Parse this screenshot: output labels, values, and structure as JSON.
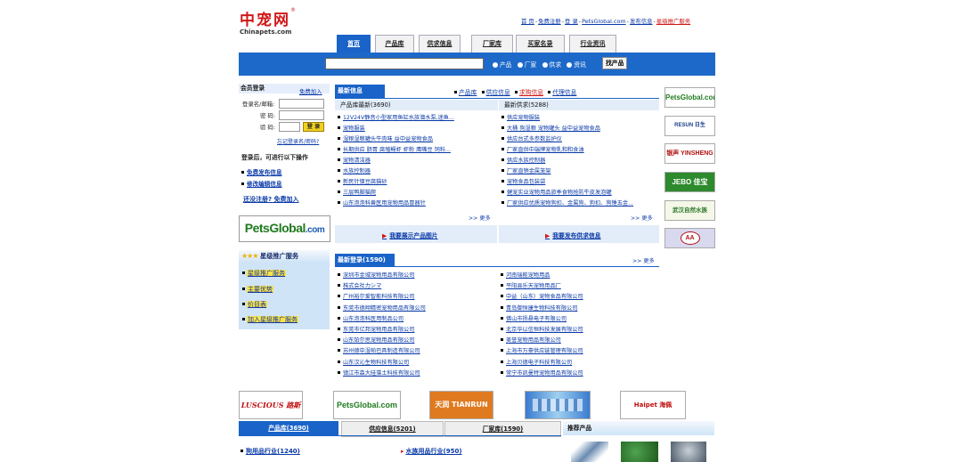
{
  "header": {
    "logo_cn": "中宠网",
    "logo_reg": "®",
    "logo_en": "Chinapets.com",
    "links": [
      "首 页",
      "免费注册",
      "登 录",
      "PetsGlobal.com",
      "发布信息"
    ],
    "promo_link": "星级推广服务"
  },
  "nav": {
    "tabs": [
      "首页",
      "产品库",
      "供求信息",
      "厂家库",
      "买家名录",
      "行业资讯"
    ],
    "active": "首页"
  },
  "search": {
    "placeholder": "",
    "options": [
      "产品",
      "厂家",
      "供求",
      "资讯"
    ],
    "button": "找产品"
  },
  "login": {
    "title": "会员登录",
    "free_join": "免费加入",
    "username_label": "登录名/邮箱:",
    "password_label": "密 码:",
    "code_label": "验 码:",
    "login_button": "登 录",
    "forgot": "忘记登录名/密码?",
    "after_login": "登录后，可进行以下操作",
    "actions": [
      "免费发布信息",
      "修改编辑信息"
    ],
    "not_registered": "还没注册? 免费加入"
  },
  "petsglobal": {
    "main": "PetsGlobal",
    "dot": ".com"
  },
  "star_service": {
    "title": "星级推广服务",
    "stars": "★★★",
    "items": [
      "星级推广服务",
      "主要优势",
      "价目表",
      "加入星级推广服务"
    ]
  },
  "newinfo": {
    "title": "最新信息",
    "cats": [
      "产品库",
      "供应信息",
      "求购信息",
      "代理信息"
    ],
    "products_head": "产品库最新(3690)",
    "supply_head": "最新供求(5288)",
    "products": [
      "12V24V静音小型家用鱼缸水族潜水泵,迷鱼...",
      "宠物服装",
      "湿粮湿粮罐头牛肉味 益中益宠物食品",
      "长期供应 肠胃 腐殖鳗虾 虾粉 鹰嘴豆 饲料...",
      "宠物清洁器",
      "水族控制器",
      "新民针镀豆腐猫砂",
      "三层鸭脚猫爬",
      "山东泡泡科兽医用宠物用品冒器针"
    ],
    "supply": [
      "供应宠物服装",
      "大桶 狗湿粮 宠物罐头 益中益宠物食品",
      "供应台式多参数监护仪",
      "厂家直供中端牌宠物乳和和食油",
      "供应水族控制器",
      "厂家直销金属笼架",
      "宠物食品包装袋",
      "健宠实业宠物用品旅季食物抢防牛皮发泡罐",
      "厂家供应优质宠物狗扣、金属狗、狗扣、狗锤五金..."
    ],
    "more": ">> 更多",
    "show_products": "我要展示产品图片",
    "post_supply": "我要发布供求信息",
    "arrow": "▶"
  },
  "newreg": {
    "title": "最新登录(1590)",
    "more": ">> 更多",
    "left": [
      "深圳市金城宠物用品有限公司",
      "株式会社力シマ",
      "广州裕尔爱智能科技有限公司",
      "东莞市德翔精密宠物用品有限公司",
      "山东泡泡科医用制品公司",
      "东莞市亿邦宠物用品有限公司",
      "山东铂尔思宠物用品有限公司",
      "苏州德中湿帕巴具制造有限公司",
      "山东汉沁生物科技有限公司",
      "镇江市森大硅藻土科技有限公司"
    ],
    "right": [
      "河南瑞能宠物用品",
      "平阳县乐天宠物用品厂",
      "中益（山东）宠物食品有限公司",
      "青岛御恒康生物科技有限公司",
      "佛山市扬悬电子有限公司",
      "北京华以信恒科技发展有限公司",
      "美誉宠物用品有限公司",
      "上海市万豪供应链管理有限公司",
      "上海贝德电子科技有限公司",
      "常宁市凯曼特宠物用品有限公司"
    ]
  },
  "right_logos": [
    "PetsGlobal.com",
    "RESUN 日生",
    "银声 YINSHENG",
    "JEBO 佳宝",
    "武汉自然水族",
    "AA"
  ],
  "bottom_logos": [
    "LUSCIOUS 路斯",
    "PetsGlobal.com",
    "天润 TIANRUN",
    "",
    "Haipet 海佩"
  ],
  "bottom_tabs": [
    "产品库(3690)",
    "供应信息(5201)",
    "厂家库(1590)"
  ],
  "recommend": "推荐产品",
  "categories": [
    {
      "name": "狗用品行业(1240)"
    },
    {
      "name": "水族用品行业(950)"
    }
  ],
  "colors": {
    "brand_red": "#d01818",
    "nav_blue": "#1a63c8",
    "panel_bg": "#e3edf9"
  }
}
